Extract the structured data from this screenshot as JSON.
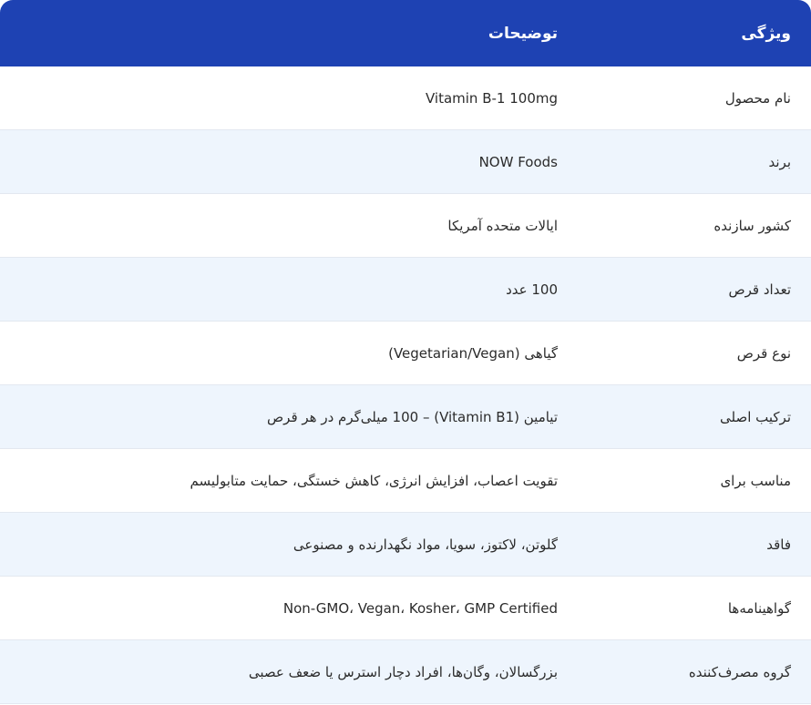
{
  "header": {
    "property": "ویژگی",
    "description": "توضیحات"
  },
  "rows": [
    {
      "property": "نام محصول",
      "description": "Vitamin B-1 100mg"
    },
    {
      "property": "برند",
      "description": "NOW Foods"
    },
    {
      "property": "کشور سازنده",
      "description": "ایالات متحده آمریکا"
    },
    {
      "property": "تعداد قرص",
      "description": "100 عدد"
    },
    {
      "property": "نوع قرص",
      "description": "گیاهی (Vegetarian/Vegan)"
    },
    {
      "property": "ترکیب اصلی",
      "description": "تیامین (Vitamin B1) – 100 میلی‌گرم در هر قرص"
    },
    {
      "property": "مناسب برای",
      "description": "تقویت اعصاب، افزایش انرژی، کاهش خستگی، حمایت متابولیسم"
    },
    {
      "property": "فاقد",
      "description": "گلوتن، لاکتوز، سویا، مواد نگهدارنده و مصنوعی"
    },
    {
      "property": "گواهینامه‌ها",
      "description": "Non-GMO، Vegan، Kosher، GMP Certified"
    },
    {
      "property": "گروه مصرف‌کننده",
      "description": "بزرگسالان، وگان‌ها، افراد دچار استرس یا ضعف عصبی"
    }
  ]
}
